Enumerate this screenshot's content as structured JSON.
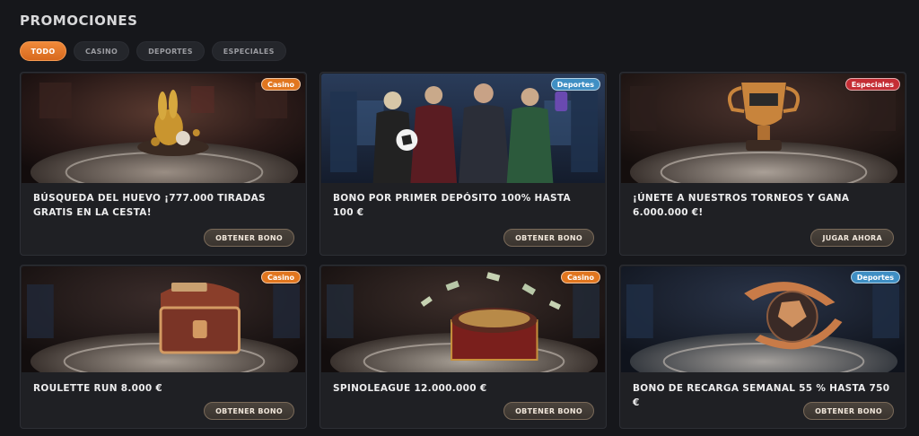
{
  "page": {
    "title": "PROMOCIONES"
  },
  "filters": [
    {
      "label": "TODO",
      "active": true
    },
    {
      "label": "CASINO",
      "active": false
    },
    {
      "label": "DEPORTES",
      "active": false
    },
    {
      "label": "ESPECIALES",
      "active": false
    }
  ],
  "colors": {
    "accent": "#e1761f",
    "casino_badge": "#e1761f",
    "deportes_badge": "#3f8fc4",
    "especiales_badge": "#c42d34",
    "background": "#16171b",
    "card": "#1f2024"
  },
  "promotions": [
    {
      "badge": "Casino",
      "title": "BÚSQUEDA DEL HUEVO ¡777.000 TIRADAS GRATIS EN LA CESTA!",
      "button": "OBTENER BONO",
      "image": "golden-rabbit-illustration"
    },
    {
      "badge": "Deportes",
      "title": "BONO POR PRIMER DEPÓSITO 100% HASTA 100 €",
      "button": "OBTENER BONO",
      "image": "football-fans-illustration"
    },
    {
      "badge": "Especiales",
      "title": "¡ÚNETE A NUESTROS TORNEOS Y GANA 6.000.000 €!",
      "button": "JUGAR AHORA",
      "image": "trophy-illustration"
    },
    {
      "badge": "Casino",
      "title": "ROULETTE RUN 8.000 €",
      "button": "OBTENER BONO",
      "image": "treasure-chest-illustration"
    },
    {
      "badge": "Casino",
      "title": "SPINOLEAGUE 12.000.000 €",
      "button": "OBTENER BONO",
      "image": "roulette-money-illustration"
    },
    {
      "badge": "Deportes",
      "title": "BONO DE RECARGA SEMANAL 55 % HASTA 750 €",
      "button": "OBTENER BONO",
      "image": "football-arrows-illustration"
    }
  ]
}
